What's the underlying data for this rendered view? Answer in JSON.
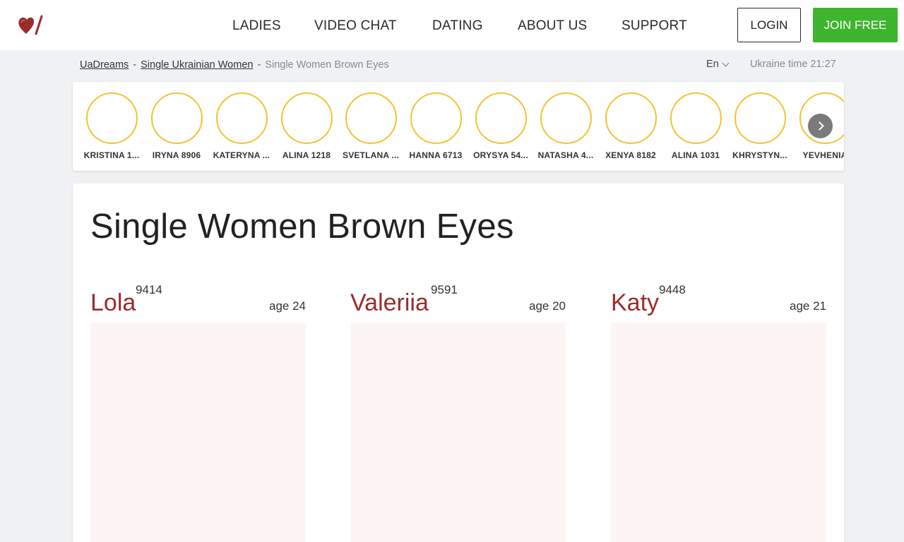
{
  "header": {
    "nav": [
      "LADIES",
      "VIDEO CHAT",
      "DATING",
      "ABOUT US",
      "SUPPORT"
    ],
    "login_label": "LOGIN",
    "join_label": "JOIN FREE",
    "brand_color": "#9b2c2c",
    "join_color": "#3fb42f"
  },
  "breadcrumb": {
    "items": [
      "UaDreams",
      "Single Ukrainian Women"
    ],
    "separator": "-",
    "current": "Single Women Brown Eyes"
  },
  "lang": "En",
  "ukraine_time": "Ukraine time 21:27",
  "stories": [
    "KRISTINA 1...",
    "IRYNA 8906",
    "KATERYNA ...",
    "ALINA 1218",
    "SVETLANA ...",
    "HANNA 6713",
    "ORYSYA 54...",
    "NATASHA 4...",
    "XENYA 8182",
    "ALINA 1031",
    "KHRYSTYN...",
    "YEVHENIA"
  ],
  "page_title": "Single Women Brown Eyes",
  "profiles": [
    {
      "name": "Lola",
      "id": "9414",
      "age": "age 24"
    },
    {
      "name": "Valeriia",
      "id": "9591",
      "age": "age 20"
    },
    {
      "name": "Katy",
      "id": "9448",
      "age": "age 21"
    }
  ]
}
